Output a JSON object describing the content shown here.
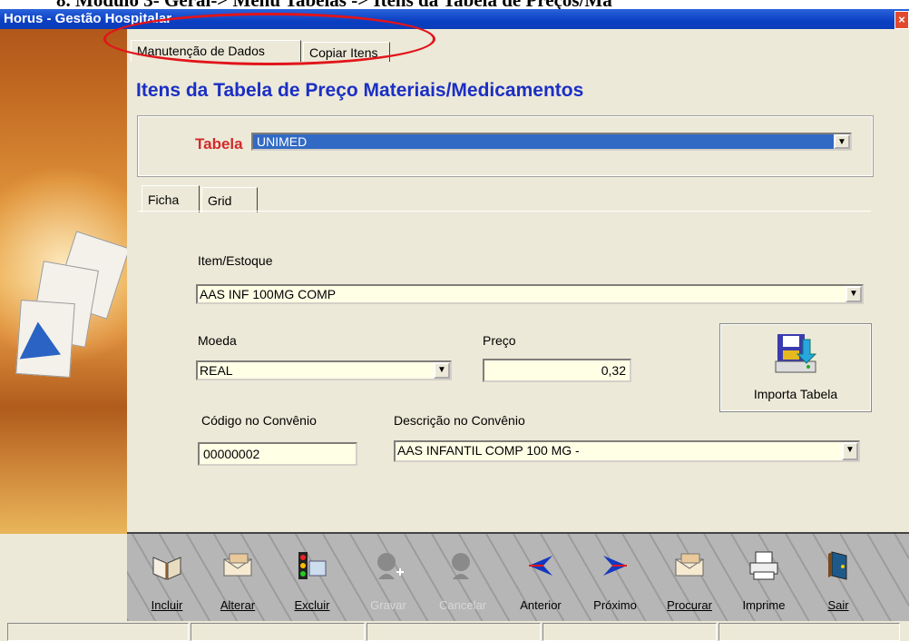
{
  "caption": "8.  Módulo 3- Geral-> Menu Tabelas -> Itens da Tabela de Preços/Ma",
  "window": {
    "title": "Horus - Gestão Hospitalar",
    "close": "×"
  },
  "top_tabs": [
    "Manutenção de Dados",
    "Copiar Itens"
  ],
  "heading": "Itens da Tabela de Preço Materiais/Medicamentos",
  "tabela": {
    "label": "Tabela",
    "value": "UNIMED"
  },
  "inner_tabs": [
    "Ficha",
    "Grid"
  ],
  "form": {
    "item_label": "Item/Estoque",
    "item_value": "AAS INF 100MG COMP",
    "moeda_label": "Moeda",
    "moeda_value": "REAL",
    "preco_label": "Preço",
    "preco_value": "0,32",
    "codigo_label": "Código no Convênio",
    "codigo_value": "00000002",
    "descricao_label": "Descrição no Convênio",
    "descricao_value": "AAS INFANTIL COMP 100 MG -"
  },
  "import_button": {
    "label": "Importa Tabela",
    "icon": "import-table-icon"
  },
  "toolbar": [
    {
      "label": "Incluir",
      "icon": "book-icon",
      "enabled": true
    },
    {
      "label": "Alterar",
      "icon": "envelope-icon",
      "enabled": true
    },
    {
      "label": "Excluir",
      "icon": "traffic-light-icon",
      "enabled": true
    },
    {
      "label": "Gravar",
      "icon": "person-plus-icon",
      "enabled": false
    },
    {
      "label": "Cancelar",
      "icon": "person-icon",
      "enabled": false
    },
    {
      "label": "Anterior",
      "icon": "arrow-left-icon",
      "enabled": true
    },
    {
      "label": "Próximo",
      "icon": "arrow-right-icon",
      "enabled": true
    },
    {
      "label": "Procurar",
      "icon": "envelope-search-icon",
      "enabled": true
    },
    {
      "label": "Imprime",
      "icon": "printer-icon",
      "enabled": true
    },
    {
      "label": "Sair",
      "icon": "door-icon",
      "enabled": true
    }
  ],
  "colors": {
    "titlebar": "#0a3fc2",
    "heading": "#1b2fc4",
    "tabela_label": "#d22a2a",
    "selected": "#316ac5",
    "annotation": "#e2141a"
  }
}
